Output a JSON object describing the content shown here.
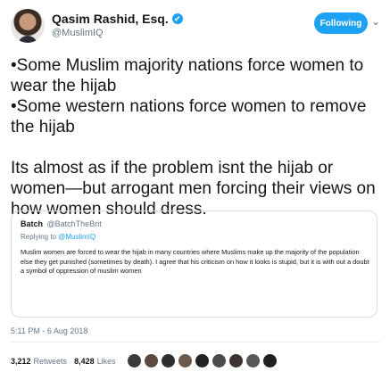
{
  "author": {
    "display_name": "Qasim Rashid, Esq.",
    "verified_mark": "✔",
    "handle": "@MuslimIQ"
  },
  "follow_button": {
    "label": "Following"
  },
  "caret": "⌄",
  "tweet": {
    "lines": [
      "•Some Muslim majority nations force women to wear the hijab",
      "•Some western nations force women to remove the hijab",
      "Its almost as if the problem isnt the hijab or women—but arrogant men forcing their views on how women should dress."
    ]
  },
  "quoted_tweet": {
    "name": "Batch",
    "handle": "@BatchTheBrit",
    "replying_prefix": "Replying to",
    "replying_handle": "@MuslimIQ",
    "body": "Muslim women are forced to wear the hijab in many countries where Muslims make up the majority of the population else they get punished (sometimes by death). I agree that his criticism on how it looks is stupid, but it is with out a doubt a symbol of oppression of muslim women"
  },
  "timestamp": "5:11 PM - 6 Aug 2018",
  "stats": {
    "retweets_count": "3,212",
    "retweets_label": "Retweets",
    "likes_count": "8,428",
    "likes_label": "Likes"
  },
  "liker_avatars": [
    {
      "color": "#3a3a3a"
    },
    {
      "color": "#5a4a3f"
    },
    {
      "color": "#2e2e2e"
    },
    {
      "color": "#6b5b4e"
    },
    {
      "color": "#222222"
    },
    {
      "color": "#4b4b4b"
    },
    {
      "color": "#3d3430"
    },
    {
      "color": "#575757"
    },
    {
      "color": "#1f1f1f"
    }
  ]
}
